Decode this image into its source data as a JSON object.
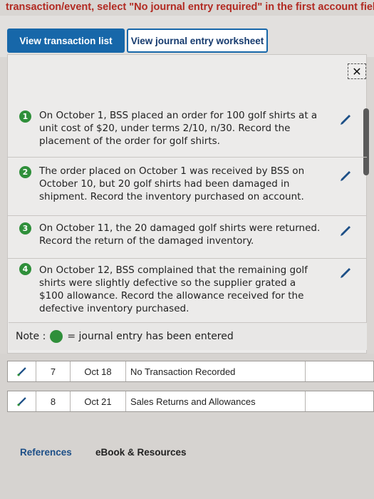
{
  "header": {
    "instruction": "transaction/event, select \"No journal entry required\" in the first account field.)"
  },
  "tabs": {
    "view_transaction_list": "View transaction list",
    "view_journal_worksheet": "View journal entry worksheet"
  },
  "panel": {
    "close_symbol": "✕",
    "transactions": [
      {
        "number": "1",
        "text": "On October 1, BSS placed an order for 100 golf shirts at a unit cost of $20, under terms 2/10, n/30. Record the placement of the order for golf shirts."
      },
      {
        "number": "2",
        "text": "The order placed on October 1 was received by BSS on October 10, but 20 golf shirts had been damaged in shipment. Record the inventory purchased on account."
      },
      {
        "number": "3",
        "text": "On October 11, the 20 damaged golf shirts were returned. Record the return of the damaged inventory."
      },
      {
        "number": "4",
        "text": "On October 12, BSS complained that the remaining golf shirts were slightly defective so the supplier grated a $100 allowance. Record the allowance received for the defective inventory purchased."
      }
    ],
    "note_label": "Note :",
    "note_text": "= journal entry has been entered"
  },
  "table": {
    "rows": [
      {
        "no": "7",
        "date": "Oct 18",
        "description": "No Transaction Recorded"
      },
      {
        "no": "8",
        "date": "Oct 21",
        "description": "Sales Returns and Allowances"
      }
    ]
  },
  "footer": {
    "references": "References",
    "ebook": "eBook & Resources"
  },
  "colors": {
    "accent_blue": "#1767a9",
    "entered_green": "#2f8f3a",
    "instruction_red": "#b22a22"
  }
}
